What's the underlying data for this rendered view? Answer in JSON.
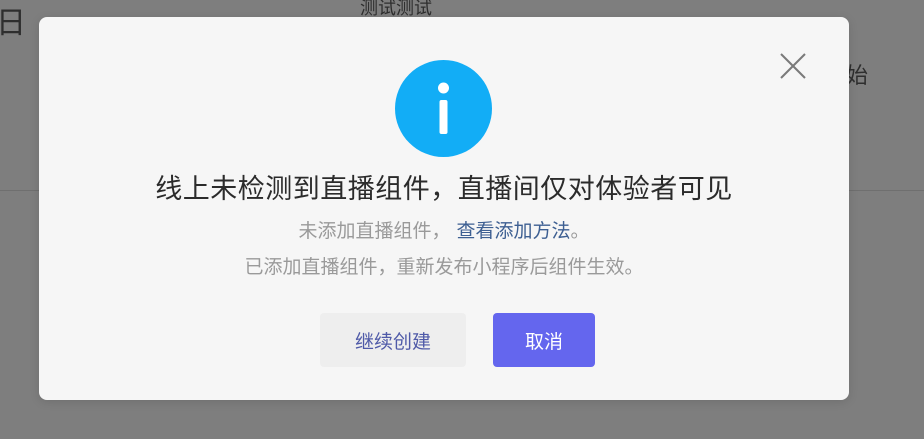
{
  "background": {
    "date_fragment": "日",
    "title_fragment": "测试测试",
    "start_fragment": "始"
  },
  "dialog": {
    "icon": "info-icon",
    "close_icon": "close-icon",
    "title": "线上未检测到直播组件，直播间仅对体验者可见",
    "line1_text": "未添加直播组件，",
    "line1_link": "查看添加方法",
    "line1_end": "。",
    "line2_text": "已添加直播组件，重新发布小程序后组件生效。",
    "continue_label": "继续创建",
    "cancel_label": "取消"
  },
  "colors": {
    "info_icon": "#12adf6",
    "primary_button": "#6466ee",
    "link": "#3d5f92",
    "overlay": "#7e7e7e"
  }
}
